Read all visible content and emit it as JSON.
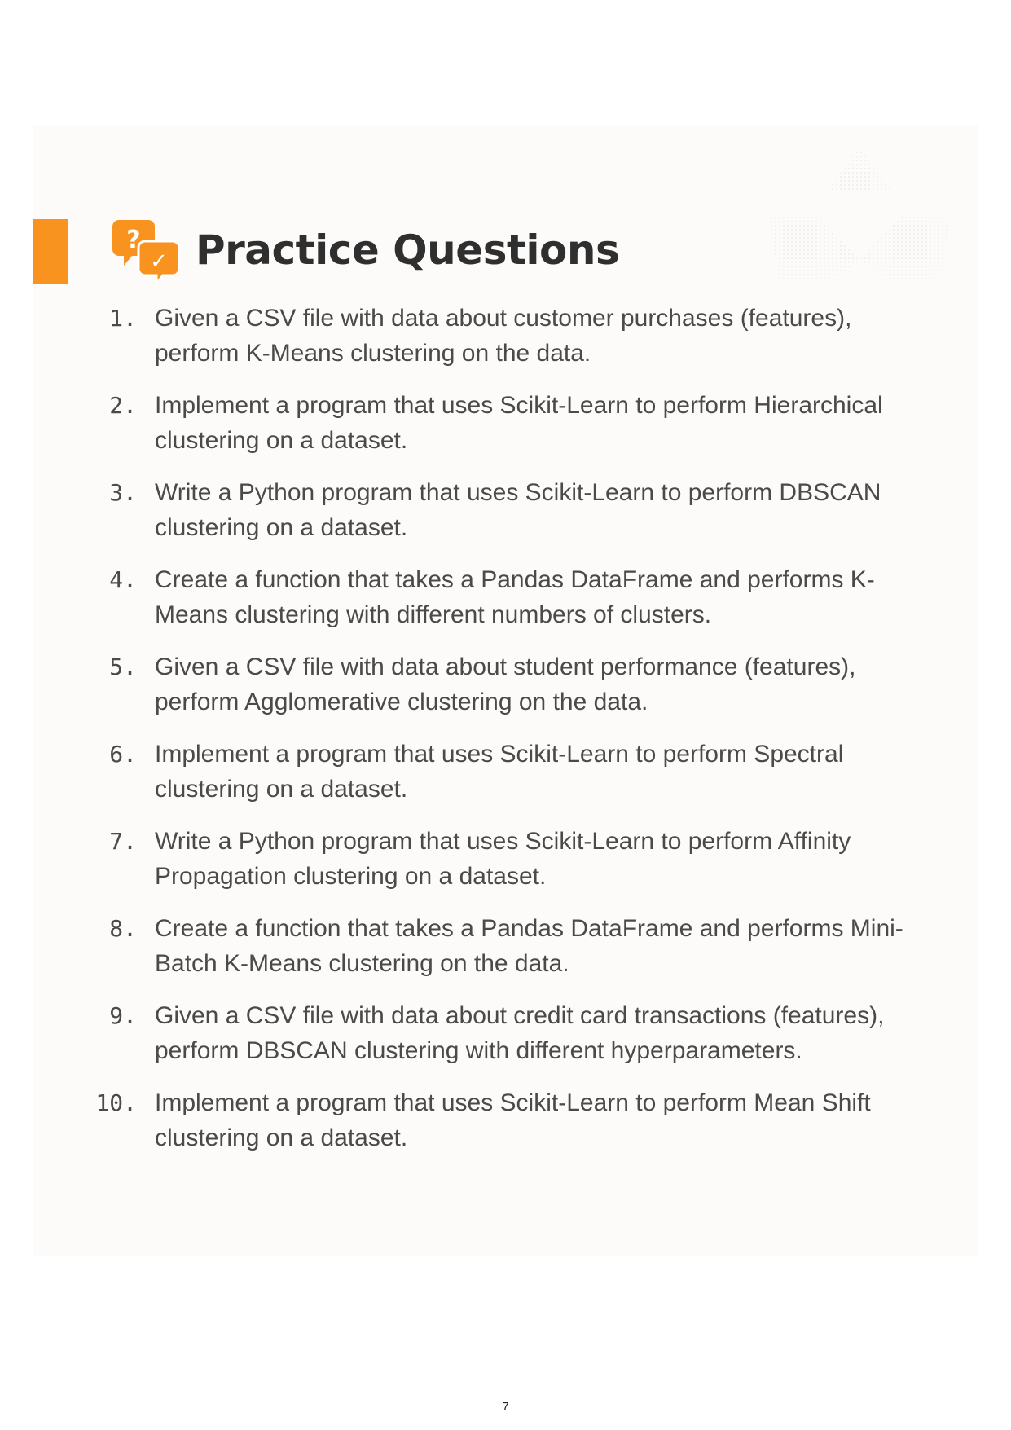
{
  "colors": {
    "accent": "#f7931e",
    "card_background": "#fdfbf9",
    "text": "#4a4a4a",
    "title": "#2f2f2f"
  },
  "header": {
    "title": "Practice Questions",
    "icon": "question-answer-chat-bubbles-icon",
    "icon_glyphs": {
      "question": "?",
      "check": "✓"
    }
  },
  "questions": [
    {
      "number": "1.",
      "text": "Given a CSV file with data about customer purchases (features), perform K-Means clustering on the data."
    },
    {
      "number": "2.",
      "text": "Implement a program that uses Scikit-Learn to perform Hierarchical clustering on a dataset."
    },
    {
      "number": "3.",
      "text": "Write a Python program that uses Scikit-Learn to perform DBSCAN clustering on a dataset."
    },
    {
      "number": "4.",
      "text": "Create a function that takes a Pandas DataFrame and performs K-Means clustering with different numbers of clusters."
    },
    {
      "number": "5.",
      "text": "Given a CSV file with data about student performance (features), perform Agglomerative clustering on the data."
    },
    {
      "number": "6.",
      "text": "Implement a program that uses Scikit-Learn to perform Spectral clustering on a dataset."
    },
    {
      "number": "7.",
      "text": "Write a Python program that uses Scikit-Learn to perform Affinity Propagation clustering on a dataset."
    },
    {
      "number": "8.",
      "text": "Create a function that takes a Pandas DataFrame and performs Mini-Batch K-Means clustering on the data."
    },
    {
      "number": "9.",
      "text": "Given a CSV file with data about credit card transactions (features), perform DBSCAN clustering with different hyperparameters."
    },
    {
      "number": "10.",
      "text": "Implement a program that uses Scikit-Learn to perform Mean Shift clustering on a dataset."
    }
  ],
  "footer": {
    "page_number": "7"
  }
}
